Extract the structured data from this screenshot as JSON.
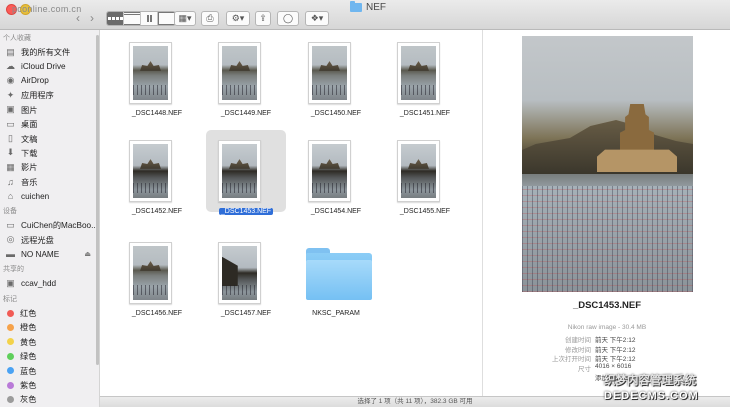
{
  "window": {
    "title": "NEF",
    "top_watermark": "pconline.com.cn"
  },
  "toolbar": {
    "back": "‹",
    "forward": "›",
    "view_modes": [
      "icon-view",
      "list-view",
      "column-view",
      "coverflow-view"
    ],
    "arrange_icon": "arrange-icon",
    "action_icon": "gear-icon",
    "share_icon": "share-icon",
    "tag_icon": "tag-icon",
    "dropbox_icon": "dropbox-icon"
  },
  "sidebar": {
    "sections": [
      {
        "header": "个人收藏",
        "items": [
          {
            "label": "我的所有文件",
            "icon": "all-files-icon",
            "glyph": "▤"
          },
          {
            "label": "iCloud Drive",
            "icon": "cloud-icon",
            "glyph": "☁"
          },
          {
            "label": "AirDrop",
            "icon": "airdrop-icon",
            "glyph": "◉"
          },
          {
            "label": "应用程序",
            "icon": "applications-icon",
            "glyph": "✦"
          },
          {
            "label": "图片",
            "icon": "pictures-icon",
            "glyph": "▣"
          },
          {
            "label": "桌面",
            "icon": "desktop-icon",
            "glyph": "▭"
          },
          {
            "label": "文稿",
            "icon": "documents-icon",
            "glyph": "▯"
          },
          {
            "label": "下载",
            "icon": "downloads-icon",
            "glyph": "⬇"
          },
          {
            "label": "影片",
            "icon": "movies-icon",
            "glyph": "▦"
          },
          {
            "label": "音乐",
            "icon": "music-icon",
            "glyph": "♫"
          },
          {
            "label": "cuichen",
            "icon": "home-icon",
            "glyph": "⌂"
          }
        ]
      },
      {
        "header": "设备",
        "items": [
          {
            "label": "CuiChen的MacBoo...",
            "icon": "laptop-icon",
            "glyph": "▭"
          },
          {
            "label": "远程光盘",
            "icon": "remote-disc-icon",
            "glyph": "◎"
          },
          {
            "label": "NO NAME",
            "icon": "drive-icon",
            "glyph": "▬",
            "eject": "⏏"
          }
        ]
      },
      {
        "header": "共享的",
        "items": [
          {
            "label": "ccav_hdd",
            "icon": "network-drive-icon",
            "glyph": "▣"
          }
        ]
      },
      {
        "header": "标记",
        "tags": [
          {
            "label": "红色",
            "color": "#f15b55"
          },
          {
            "label": "橙色",
            "color": "#f6a24a"
          },
          {
            "label": "黄色",
            "color": "#f3d24a"
          },
          {
            "label": "绿色",
            "color": "#5fcf5b"
          },
          {
            "label": "蓝色",
            "color": "#4aa2f3"
          },
          {
            "label": "紫色",
            "color": "#b97ad8"
          },
          {
            "label": "灰色",
            "color": "#9b9b9b"
          }
        ]
      }
    ]
  },
  "files": [
    {
      "name": "_DSC1448.NEF",
      "kind": "image",
      "variant": "normal"
    },
    {
      "name": "_DSC1449.NEF",
      "kind": "image",
      "variant": "normal"
    },
    {
      "name": "_DSC1450.NEF",
      "kind": "image",
      "variant": "normal"
    },
    {
      "name": "_DSC1451.NEF",
      "kind": "image",
      "variant": "normal"
    },
    {
      "name": "_DSC1452.NEF",
      "kind": "image",
      "variant": "dark"
    },
    {
      "name": "_DSC1453.NEF",
      "kind": "image",
      "variant": "dark",
      "selected": true
    },
    {
      "name": "_DSC1454.NEF",
      "kind": "image",
      "variant": "dark"
    },
    {
      "name": "_DSC1455.NEF",
      "kind": "image",
      "variant": "dark"
    },
    {
      "name": "_DSC1456.NEF",
      "kind": "image",
      "variant": "normal"
    },
    {
      "name": "_DSC1457.NEF",
      "kind": "image",
      "variant": "left"
    },
    {
      "name": "NKSC_PARAM",
      "kind": "folder"
    }
  ],
  "preview": {
    "name": "_DSC1453.NEF",
    "kind": "Nikon raw image - 30.4 MB",
    "rows": [
      {
        "key": "创建时间",
        "value": "前天 下午2:12"
      },
      {
        "key": "修改时间",
        "value": "前天 下午2:12"
      },
      {
        "key": "上次打开时间",
        "value": "前天 下午2:12"
      },
      {
        "key": "尺寸",
        "value": "4016 × 6016"
      }
    ],
    "add_tags": "添加标记..."
  },
  "status": "选择了 1 项（共 11 项），382.3 GB 可用",
  "watermark": {
    "line1": "织梦内容管理系统",
    "line2": "DEDECMS.COM"
  }
}
